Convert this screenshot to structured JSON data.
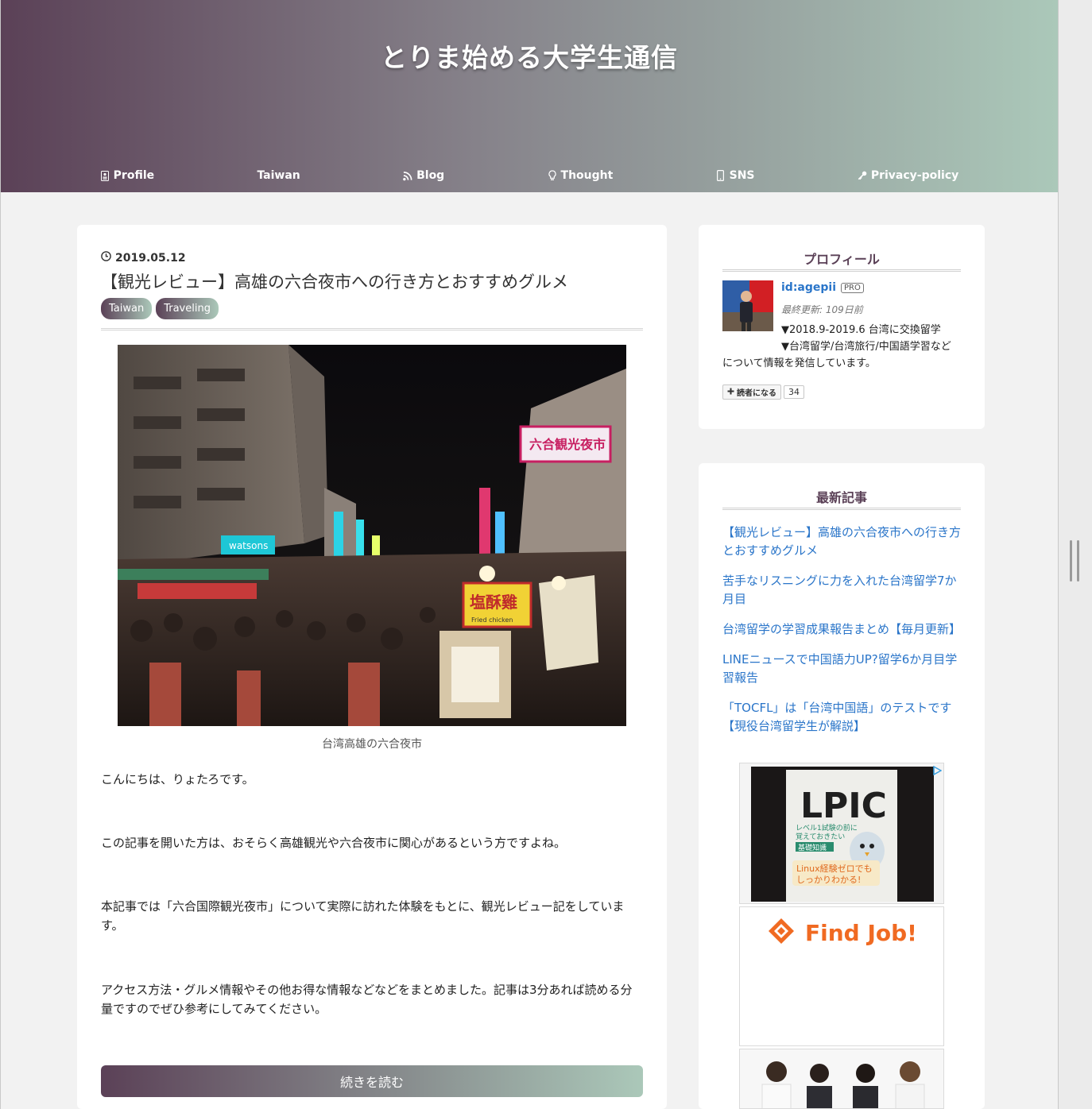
{
  "site": {
    "title": "とりま始める大学生通信",
    "colors": {
      "gradient_start": "#5b4157",
      "gradient_end": "#abc8b9",
      "link": "#2a75c9"
    }
  },
  "nav": [
    {
      "label": "Profile",
      "icon": "id-card-icon"
    },
    {
      "label": "Taiwan",
      "icon": ""
    },
    {
      "label": "Blog",
      "icon": "rss-icon"
    },
    {
      "label": "Thought",
      "icon": "lightbulb-icon"
    },
    {
      "label": "SNS",
      "icon": "mobile-icon"
    },
    {
      "label": "Privacy-policy",
      "icon": "key-icon"
    }
  ],
  "article": {
    "date": "2019.05.12",
    "title": "【観光レビュー】高雄の六合夜市への行き方とおすすめグルメ",
    "tags": [
      "Taiwan",
      "Traveling"
    ],
    "image_caption": "台湾高雄の六合夜市",
    "paragraphs": [
      "こんにちは、りょたろです。",
      "この記事を開いた方は、おそらく高雄観光や六合夜市に関心があるという方ですよね。",
      "本記事では「六合国際観光夜市」について実際に訪れた体験をもとに、観光レビュー記をしています。",
      "アクセス方法・グルメ情報やその他お得な情報などなどをまとめました。記事は3分あれば読める分量ですのでぜひ参考にしてみてください。"
    ],
    "read_more": "続きを読む",
    "photo_signs": {
      "market": "六合観光夜市",
      "stall": "塩酥雞",
      "stall_sub": "Fried chicken",
      "watsons": "watsons"
    }
  },
  "profile": {
    "heading": "プロフィール",
    "id": "id:agepii",
    "badge": "PRO",
    "last_updated": "最終更新: 109日前",
    "bio_line1": "▼2018.9-2019.6 台湾に交換留学",
    "bio_line2": "▼台湾留学/台湾旅行/中国語学習などについて情報を発信しています。",
    "subscribe_label": "読者になる",
    "subscribers": "34"
  },
  "recent": {
    "heading": "最新記事",
    "items": [
      "【観光レビュー】高雄の六合夜市への行き方とおすすめグルメ",
      "苦手なリスニングに力を入れた台湾留学7か月目",
      "台湾留学の学習成果報告まとめ【毎月更新】",
      "LINEニュースで中国語力UP?留学6か月目学習報告",
      "「TOCFL」は「台湾中国語」のテストです【現役台湾留学生が解説】"
    ]
  },
  "ads": {
    "book_title": "LPIC",
    "book_sub1": "レベル1試験の前に",
    "book_sub2": "覚えておきたい",
    "book_band": "基礎知識",
    "book_tag1": "Linux経験ゼロでも",
    "book_tag2": "しっかりわかる!",
    "job_brand": "Find Job!"
  }
}
